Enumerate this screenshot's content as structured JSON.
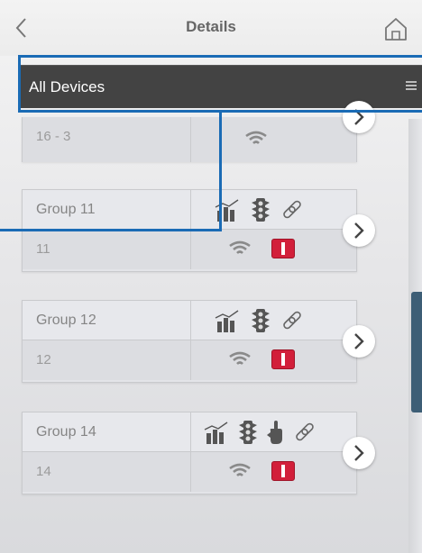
{
  "header": {
    "title": "Details",
    "back_icon": "chevron-left-icon",
    "home_icon": "home-icon"
  },
  "filter": {
    "label": "All Devices",
    "menu_icon": "menu-lines-icon"
  },
  "colors": {
    "highlight": "#1a6bb5",
    "filter_bar": "#434343",
    "alert": "#d21f3a",
    "scroll_thumb": "#3d5e76"
  },
  "cards": [
    {
      "id": "16 - 3",
      "name": "",
      "icons": [],
      "status": [
        "wifi-icon"
      ]
    },
    {
      "name": "Group 11",
      "id": "11",
      "icons": [
        "chart-icon",
        "traffic-light-icon",
        "link-icon"
      ],
      "status": [
        "wifi-icon",
        "alert-icon"
      ]
    },
    {
      "name": "Group 12",
      "id": "12",
      "icons": [
        "chart-icon",
        "traffic-light-icon",
        "link-icon"
      ],
      "status": [
        "wifi-icon",
        "alert-icon"
      ]
    },
    {
      "name": "Group 14",
      "id": "14",
      "icons": [
        "chart-icon",
        "traffic-light-icon",
        "hand-icon",
        "link-icon"
      ],
      "status": [
        "wifi-icon",
        "alert-icon"
      ]
    }
  ]
}
